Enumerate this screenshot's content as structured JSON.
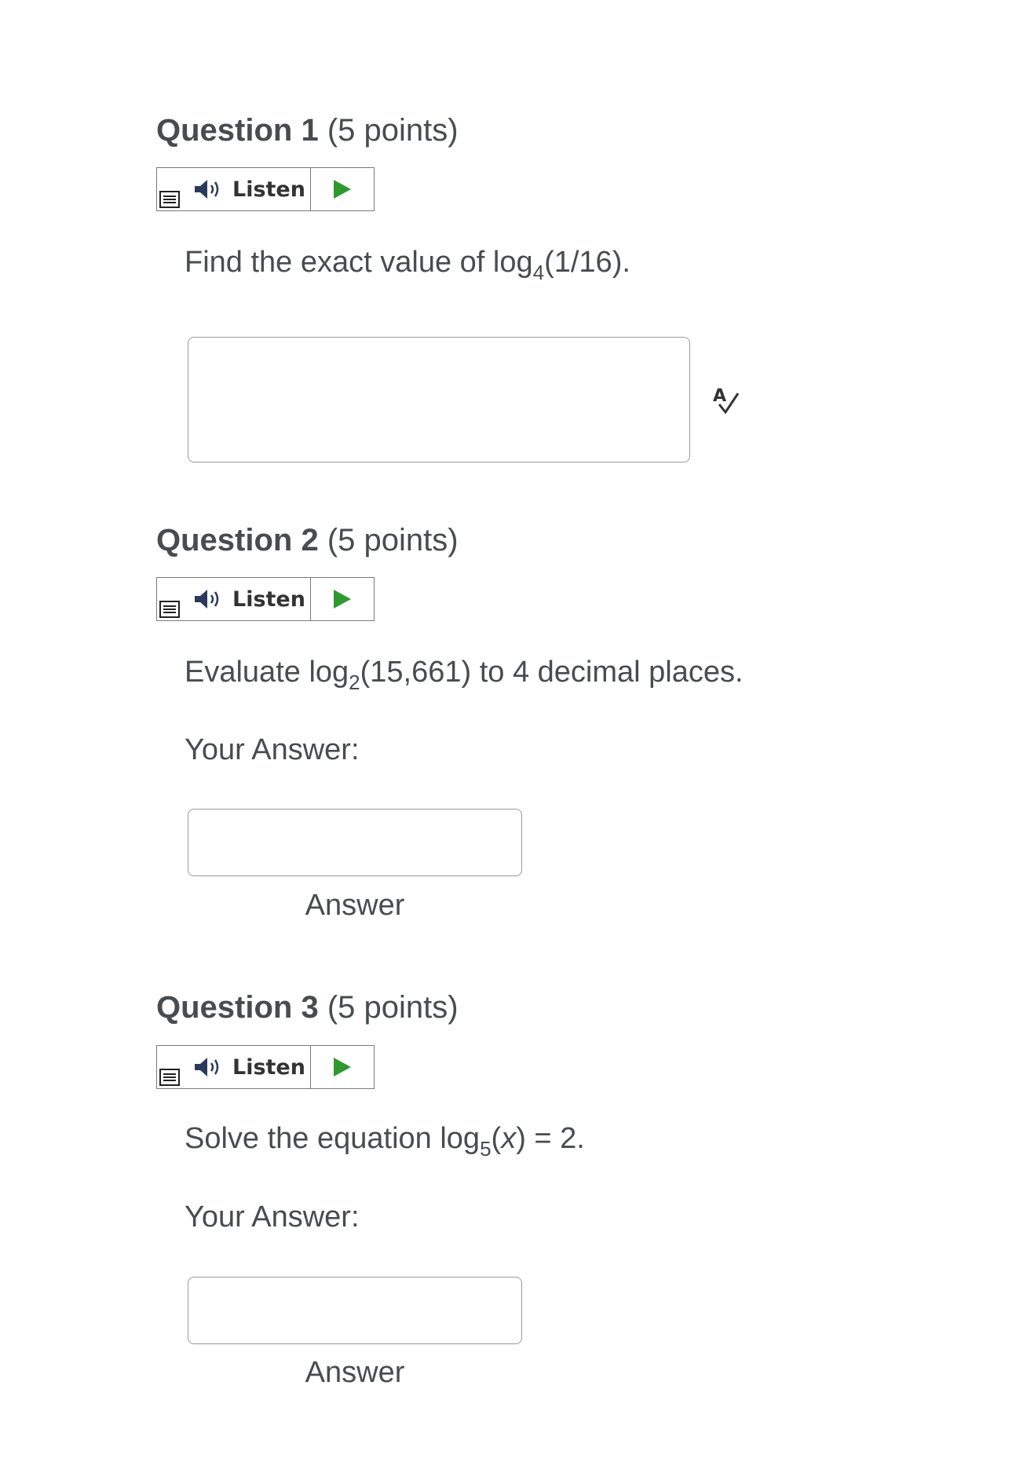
{
  "listen": {
    "label": "Listen"
  },
  "questions": [
    {
      "title": "Question 1",
      "points": "(5 points)",
      "prompt_before": "Find the exact value of log",
      "prompt_sub": "4",
      "prompt_after": "(1/16).",
      "response_type": "essay"
    },
    {
      "title": "Question 2",
      "points": "(5 points)",
      "prompt_before": "Evaluate log",
      "prompt_sub": "2",
      "prompt_after": "(15,661) to 4 decimal places.",
      "your_answer_label": "Your Answer:",
      "answer_caption": "Answer",
      "response_type": "short"
    },
    {
      "title": "Question 3",
      "points": "(5 points)",
      "prompt_before": "Solve the equation log",
      "prompt_sub": "5",
      "prompt_var": "x",
      "prompt_after": " = 2.",
      "your_answer_label": "Your Answer:",
      "answer_caption": "Answer",
      "response_type": "short"
    }
  ],
  "colors": {
    "text": "#494c4e",
    "play_green": "#2e9a2e",
    "border": "#9a9a9a"
  },
  "icons": {
    "speaker": "speaker-icon",
    "play": "play-icon",
    "menu": "menu-icon",
    "spellcheck": "spellcheck-icon"
  }
}
